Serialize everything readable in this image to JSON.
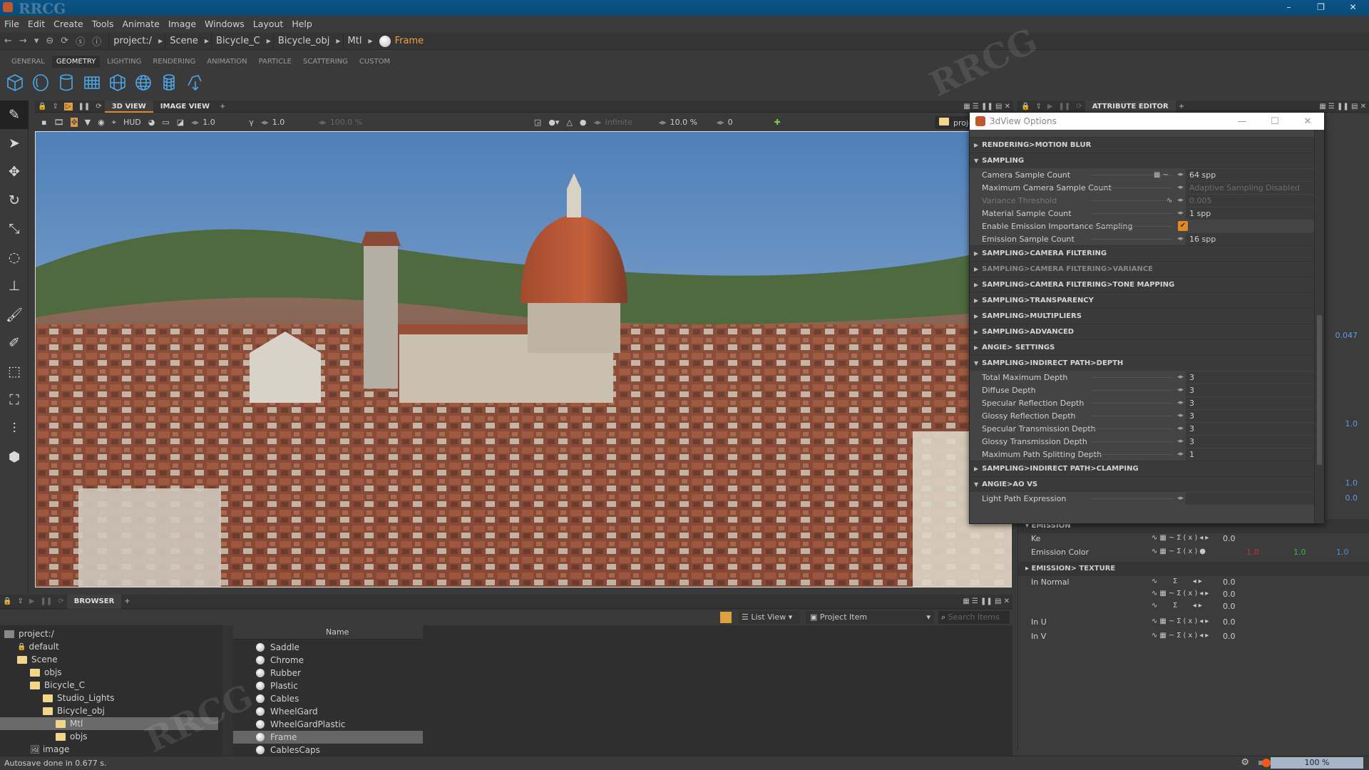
{
  "window": {
    "watermark": "RRCG",
    "controls": [
      "–",
      "❐",
      "✕"
    ]
  },
  "menu": [
    "File",
    "Edit",
    "Create",
    "Tools",
    "Animate",
    "Image",
    "Windows",
    "Layout",
    "Help"
  ],
  "breadcrumb": {
    "items": [
      "project:/",
      "Scene",
      "Bicycle_C",
      "Bicycle_obj",
      "Mtl"
    ],
    "current": "Frame"
  },
  "shelf": {
    "tabs": [
      "GENERAL",
      "GEOMETRY",
      "LIGHTING",
      "RENDERING",
      "ANIMATION",
      "PARTICLE",
      "SCATTERING",
      "CUSTOM"
    ],
    "active": "GEOMETRY",
    "icons": [
      "cube-icon",
      "sphere-icon",
      "cylinder-icon",
      "plane-grid-icon",
      "geodesic-cube-icon",
      "globe-icon",
      "mesh-cylinder-icon",
      "import-geometry-icon"
    ],
    "icon_color": "#4aa8e8"
  },
  "left_tools": [
    "eyedropper-icon",
    "select-arrow-icon",
    "move-icon",
    "rotate-icon",
    "scale-icon",
    "pivot-icon",
    "stamp-icon",
    "paint-brush-icon",
    "brush-icon",
    "frame-icon",
    "focus-icon",
    "measure-icon",
    "shapes-icon"
  ],
  "viewport": {
    "tabs": [
      "3D VIEW",
      "IMAGE VIEW"
    ],
    "active_tab": "3D VIEW",
    "add": "+",
    "hud": "HUD",
    "exposure": "1.0",
    "gamma": "1.0",
    "zoom": "100.0 %",
    "max_time": "Infinite",
    "progress": "10.0 %",
    "frame": "0",
    "path": "project://Scene"
  },
  "attribute_editor": {
    "tab": "ATTRIBUTE EDITOR",
    "add": "+",
    "side_values": [
      "0.047",
      "1.0",
      "1.0",
      "0.0"
    ],
    "sections": [
      {
        "header": "EMISSION"
      },
      {
        "label": "Ke",
        "value": "0.0"
      },
      {
        "label": "Emission Color",
        "r": "1.0",
        "g": "1.0",
        "b": "1.0"
      },
      {
        "header": "EMISSION> TEXTURE"
      },
      {
        "label": "In Normal",
        "values": [
          "0.0",
          "0.0",
          "0.0"
        ]
      },
      {
        "label": "In U",
        "value": "0.0"
      },
      {
        "label": "In V",
        "value": "0.0"
      }
    ]
  },
  "dialog": {
    "title": "3dView Options",
    "items": [
      {
        "type": "header",
        "label": "RENDERING>MOTION BLUR",
        "expanded": false
      },
      {
        "type": "header",
        "label": "SAMPLING",
        "expanded": true
      },
      {
        "type": "row",
        "label": "Camera Sample Count",
        "value": "64 spp",
        "extra": true
      },
      {
        "type": "row",
        "label": "Maximum Camera Sample Count",
        "value": "Adaptive Sampling Disabled",
        "disabled_value": true
      },
      {
        "type": "row",
        "label": "Variance Threshold",
        "value": "0.005",
        "disabled": true
      },
      {
        "type": "row",
        "label": "Material Sample Count",
        "value": "1 spp"
      },
      {
        "type": "check",
        "label": "Enable Emission Importance Sampling",
        "checked": true
      },
      {
        "type": "row",
        "label": "Emission Sample Count",
        "value": "16 spp"
      },
      {
        "type": "header",
        "label": "SAMPLING>CAMERA FILTERING",
        "expanded": false
      },
      {
        "type": "header",
        "label": "SAMPLING>CAMERA FILTERING>VARIANCE",
        "expanded": false,
        "dim": true
      },
      {
        "type": "header",
        "label": "SAMPLING>CAMERA FILTERING>TONE MAPPING",
        "expanded": false
      },
      {
        "type": "header",
        "label": "SAMPLING>TRANSPARENCY",
        "expanded": false
      },
      {
        "type": "header",
        "label": "SAMPLING>MULTIPLIERS",
        "expanded": false
      },
      {
        "type": "header",
        "label": "SAMPLING>ADVANCED",
        "expanded": false
      },
      {
        "type": "header",
        "label": "ANGIE> SETTINGS",
        "expanded": false
      },
      {
        "type": "header",
        "label": "SAMPLING>INDIRECT PATH>DEPTH",
        "expanded": true
      },
      {
        "type": "row",
        "label": "Total Maximum Depth",
        "value": "3"
      },
      {
        "type": "row",
        "label": "Diffuse Depth",
        "value": "3"
      },
      {
        "type": "row",
        "label": "Specular Reflection Depth",
        "value": "3"
      },
      {
        "type": "row",
        "label": "Glossy Reflection Depth",
        "value": "3"
      },
      {
        "type": "row",
        "label": "Specular Transmission Depth",
        "value": "3"
      },
      {
        "type": "row",
        "label": "Glossy Transmission Depth",
        "value": "3"
      },
      {
        "type": "row",
        "label": "Maximum Path Splitting Depth",
        "value": "1"
      },
      {
        "type": "header",
        "label": "SAMPLING>INDIRECT PATH>CLAMPING",
        "expanded": false
      },
      {
        "type": "header",
        "label": "ANGIE>AO VS",
        "expanded": true
      },
      {
        "type": "row",
        "label": "Light Path Expression",
        "value": ""
      }
    ]
  },
  "browser": {
    "tab": "BROWSER",
    "add": "+",
    "view_mode": "List View",
    "filter": "Project Item",
    "search_placeholder": "Search Items",
    "tree": [
      {
        "label": "project:/",
        "depth": 0,
        "icon": "project"
      },
      {
        "label": "default",
        "depth": 1,
        "icon": "lock"
      },
      {
        "label": "Scene",
        "depth": 1,
        "icon": "folder"
      },
      {
        "label": "objs",
        "depth": 2,
        "icon": "folder"
      },
      {
        "label": "Bicycle_C",
        "depth": 2,
        "icon": "folder"
      },
      {
        "label": "Studio_Lights",
        "depth": 3,
        "icon": "folder"
      },
      {
        "label": "Bicycle_obj",
        "depth": 3,
        "icon": "folder"
      },
      {
        "label": "Mtl",
        "depth": 4,
        "icon": "folder",
        "selected": true
      },
      {
        "label": "objs",
        "depth": 4,
        "icon": "folder"
      },
      {
        "label": "image",
        "depth": 2,
        "icon": "image"
      }
    ],
    "column": "Name",
    "items": [
      "Saddle",
      "Chrome",
      "Rubber",
      "Plastic",
      "Cables",
      "WheelGard",
      "WheelGardPlastic",
      "Frame",
      "CablesCaps"
    ],
    "selected_item": "Frame"
  },
  "status": {
    "message": "Autosave done in 0.677 s.",
    "zoom": "100 %",
    "render_indicator_color": "#f05a1a"
  },
  "colors": {
    "accent": "#e08a2a",
    "title_bar": "#0a4f7d",
    "red": "#c0392b",
    "green": "#4caf50",
    "blue": "#4a8fd0"
  }
}
